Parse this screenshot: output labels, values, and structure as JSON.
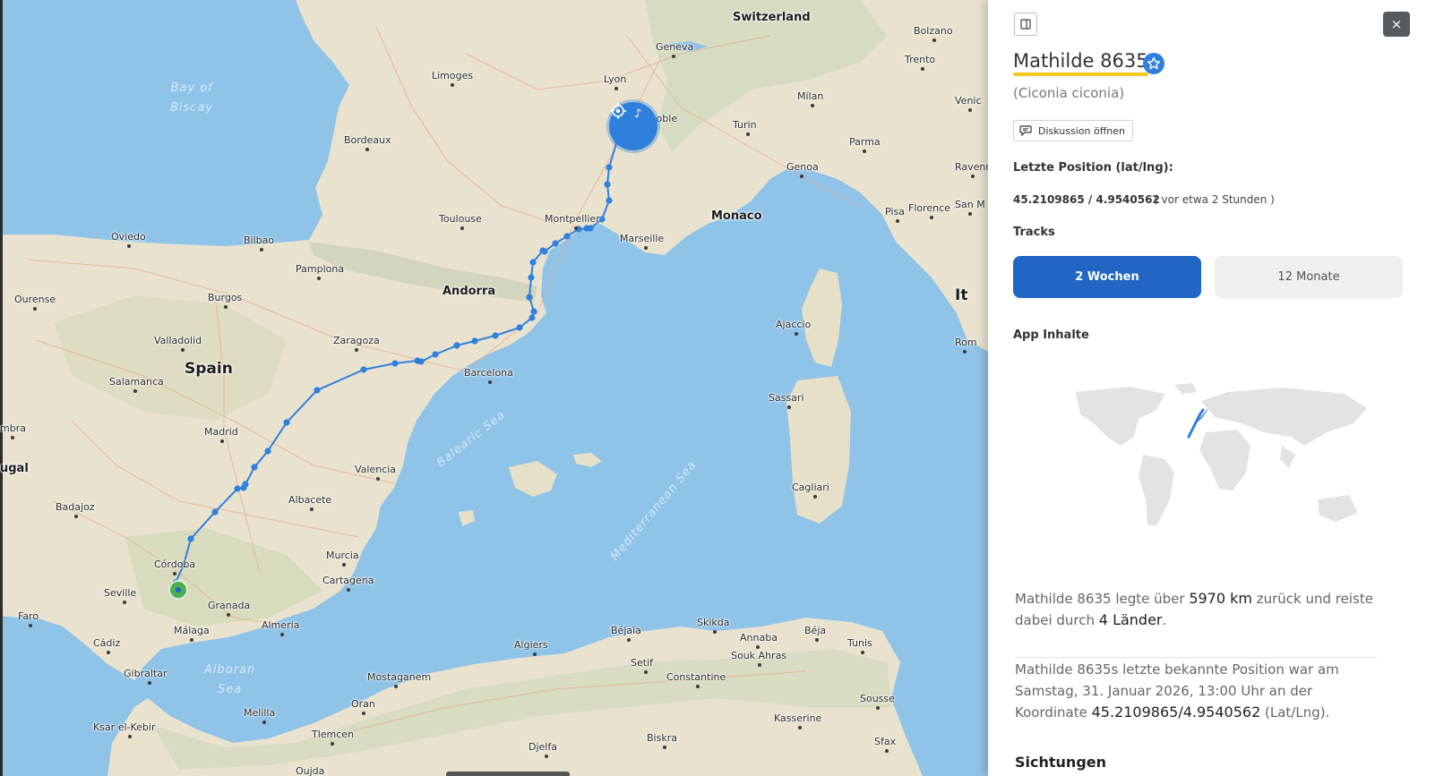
{
  "map": {
    "countries": [
      {
        "name": "Switzerland"
      },
      {
        "name": "Spain"
      },
      {
        "name": "Andorra"
      },
      {
        "name": "Monaco"
      },
      {
        "name": "It"
      },
      {
        "name": "ugal"
      }
    ],
    "cities": [
      "Geneva",
      "Bolzano",
      "Trento",
      "Venic",
      "Lyon",
      "Limoges",
      "Grenoble",
      "Milan",
      "Turin",
      "Parma",
      "Ravenn",
      "Genoa",
      "Bordeaux",
      "San M",
      "Florence",
      "Pisa",
      "Toulouse",
      "Montpellier",
      "Marseille",
      "Bilbao",
      "Oviedo",
      "Pamplona",
      "Ajaccio",
      "Burgos",
      "Ourense",
      "Rom",
      "Valladolid",
      "Zaragoza",
      "Barcelona",
      "Salamanca",
      "Sassari",
      "Madrid",
      "mbra",
      "Cagliari",
      "Valencia",
      "Badajoz",
      "Albacete",
      "Murcia",
      "Córdoba",
      "Cartagena",
      "Seville",
      "Granada",
      "Faro",
      "Almeria",
      "Málaga",
      "Skikda",
      "Cádiz",
      "Béjaïa",
      "Annaba",
      "Béja",
      "Tunis",
      "Gibraltar",
      "Algiers",
      "Souk Ahras",
      "Setif",
      "Constantine",
      "Mostaganem",
      "Sousse",
      "Oran",
      "Melilla",
      "Kasserine",
      "Ksar el-Kebir",
      "Tlemcen",
      "Biskra",
      "Djelfa",
      "Sfax",
      "Oujda"
    ],
    "seas": [
      "Bay of Biscay",
      "Balearic Sea",
      "Mediterranean Sea",
      "Alboran Sea"
    ],
    "track_color": "#2f80dc",
    "start_marker_color": "#4caf50",
    "current_marker_icon": "location-target-icon"
  },
  "panel": {
    "toggle_icon": "sidebar-toggle-icon",
    "close_label": "×",
    "bird_name": "Mathilde 8635",
    "badge_icon": "star-badge-icon",
    "species": "(Ciconia ciconia)",
    "discussion_label": "Diskussion öffnen",
    "last_position_label": "Letzte Position (lat/lng):",
    "last_position_value": "45.2109865 / 4.9540562",
    "last_position_ago": "( vor etwa 2 Stunden )",
    "tracks_label": "Tracks",
    "track_options": [
      "2 Wochen",
      "12 Monate"
    ],
    "selected_track": "2 Wochen",
    "app_content_label": "App Inhalte",
    "summary": {
      "pre": "Mathilde 8635 legte über ",
      "distance": "5970 km",
      "mid": " zurück und reiste dabei durch ",
      "countries": "4 Länder",
      "post": "."
    },
    "last_known": {
      "pre": "Mathilde 8635s letzte bekannte Position war am Samstag, 31. Januar 2026, 13:00 Uhr an der Koordinate ",
      "coords": "45.2109865/4.9540562",
      "post": " (Lat/Lng)."
    },
    "sightings_label": "Sichtungen",
    "accent_color": "#2166c4",
    "name_underline_color": "#f2c81a"
  }
}
